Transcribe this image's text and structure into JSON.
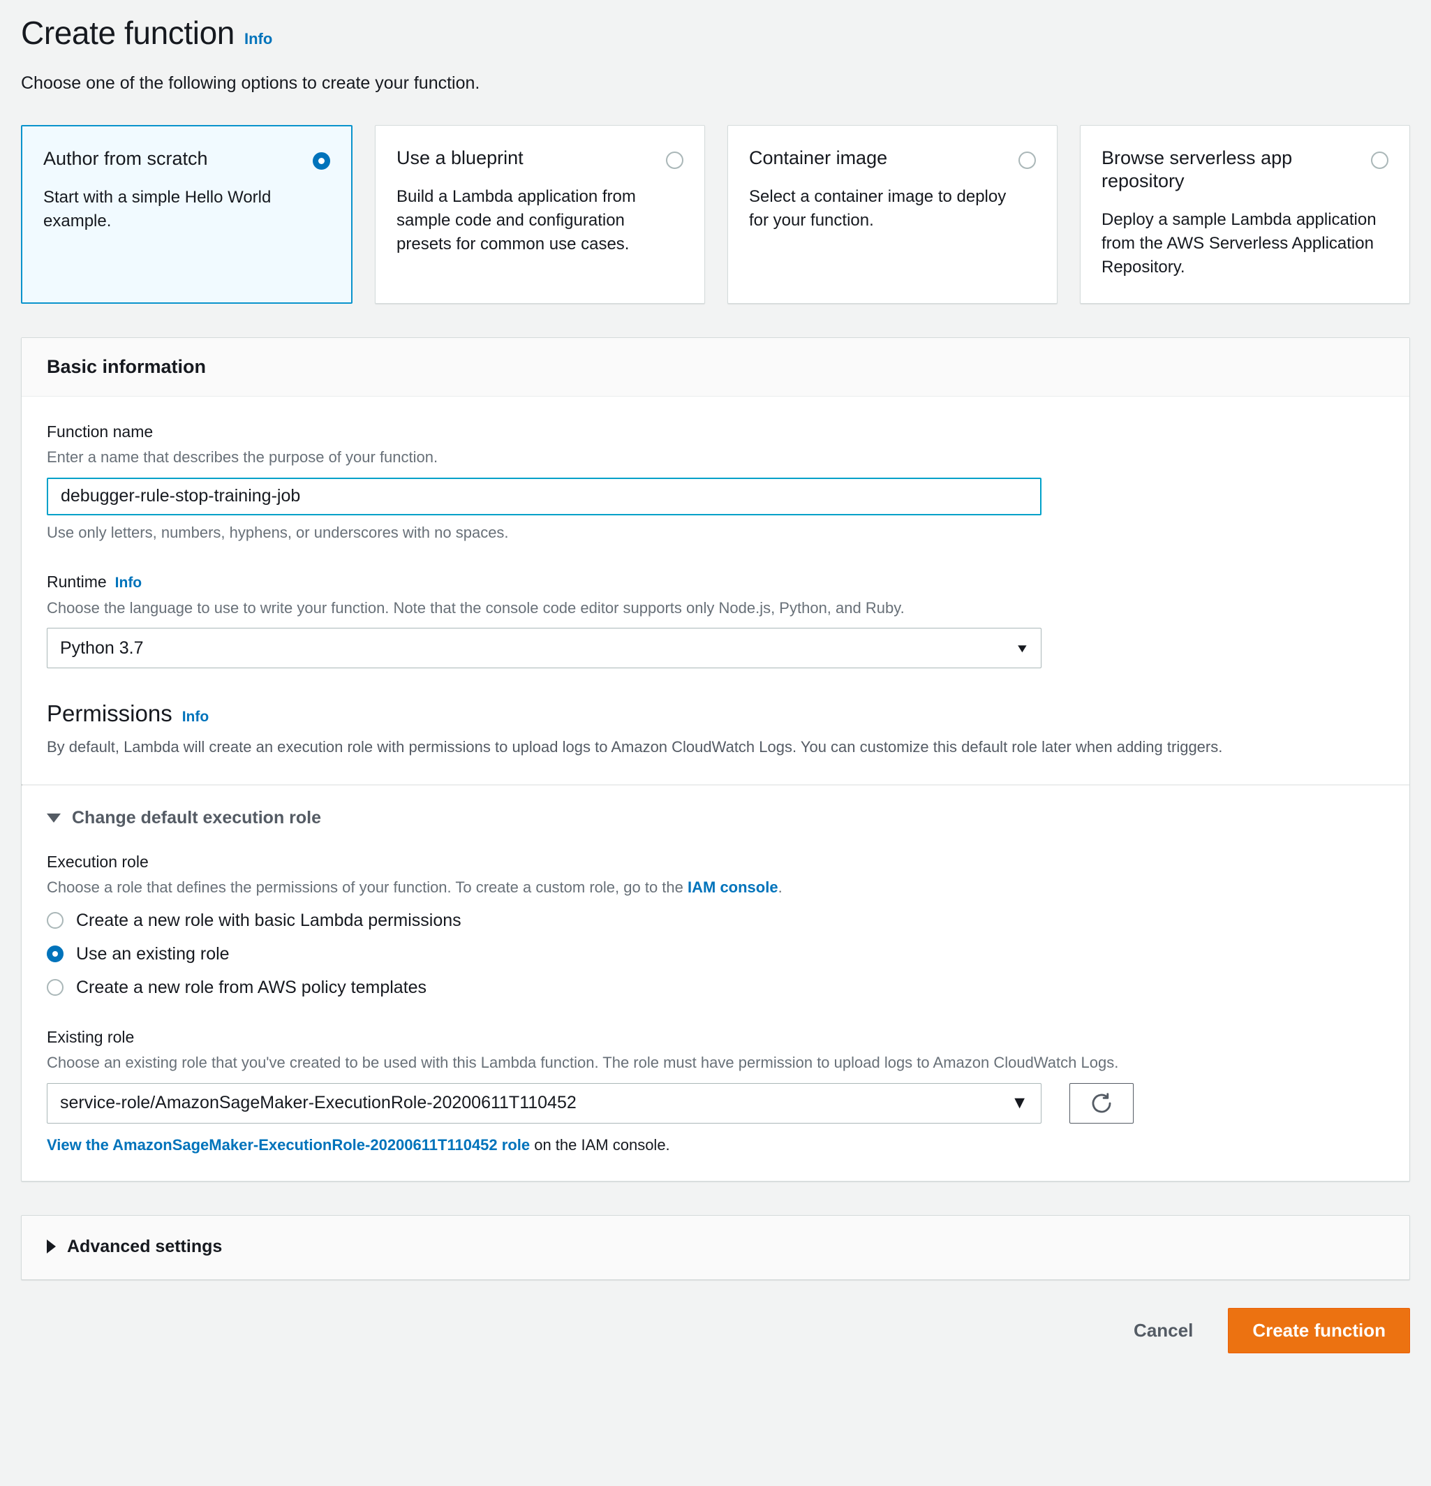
{
  "header": {
    "title": "Create function",
    "info_label": "Info",
    "subtitle": "Choose one of the following options to create your function."
  },
  "creation_options": [
    {
      "title": "Author from scratch",
      "description": "Start with a simple Hello World example.",
      "selected": true
    },
    {
      "title": "Use a blueprint",
      "description": "Build a Lambda application from sample code and configuration presets for common use cases.",
      "selected": false
    },
    {
      "title": "Container image",
      "description": "Select a container image to deploy for your function.",
      "selected": false
    },
    {
      "title": "Browse serverless app repository",
      "description": "Deploy a sample Lambda application from the AWS Serverless Application Repository.",
      "selected": false
    }
  ],
  "basic_information": {
    "panel_title": "Basic information",
    "function_name": {
      "label": "Function name",
      "hint": "Enter a name that describes the purpose of your function.",
      "value": "debugger-rule-stop-training-job",
      "placeholder": "",
      "constraint": "Use only letters, numbers, hyphens, or underscores with no spaces."
    },
    "runtime": {
      "label": "Runtime",
      "info_label": "Info",
      "hint": "Choose the language to use to write your function. Note that the console code editor supports only Node.js, Python, and Ruby.",
      "selected": "Python 3.7"
    },
    "permissions": {
      "heading": "Permissions",
      "info_label": "Info",
      "description": "By default, Lambda will create an execution role with permissions to upload logs to Amazon CloudWatch Logs. You can customize this default role later when adding triggers."
    }
  },
  "execution_role_section": {
    "expander_label": "Change default execution role",
    "expanded": true,
    "execution_role": {
      "label": "Execution role",
      "hint_before_link": "Choose a role that defines the permissions of your function. To create a custom role, go to the ",
      "hint_link": "IAM console",
      "hint_after_link": ".",
      "options": [
        {
          "label": "Create a new role with basic Lambda permissions",
          "selected": false
        },
        {
          "label": "Use an existing role",
          "selected": true
        },
        {
          "label": "Create a new role from AWS policy templates",
          "selected": false
        }
      ]
    },
    "existing_role": {
      "label": "Existing role",
      "hint": "Choose an existing role that you've created to be used with this Lambda function. The role must have permission to upload logs to Amazon CloudWatch Logs.",
      "selected": "service-role/AmazonSageMaker-ExecutionRole-20200611T110452",
      "refresh_icon": "refresh-icon",
      "view_link_text": "View the AmazonSageMaker-ExecutionRole-20200611T110452 role",
      "view_link_suffix": " on the IAM console."
    }
  },
  "advanced_settings": {
    "label": "Advanced settings",
    "expanded": false
  },
  "footer": {
    "cancel_label": "Cancel",
    "create_label": "Create function"
  },
  "colors": {
    "accent_blue": "#0073BB",
    "focus_cyan": "#00A1C9",
    "selected_card_border": "#0A93CC",
    "selected_card_bg": "#F1FAFF",
    "primary_orange": "#EC7211",
    "page_bg": "#F2F3F3"
  }
}
